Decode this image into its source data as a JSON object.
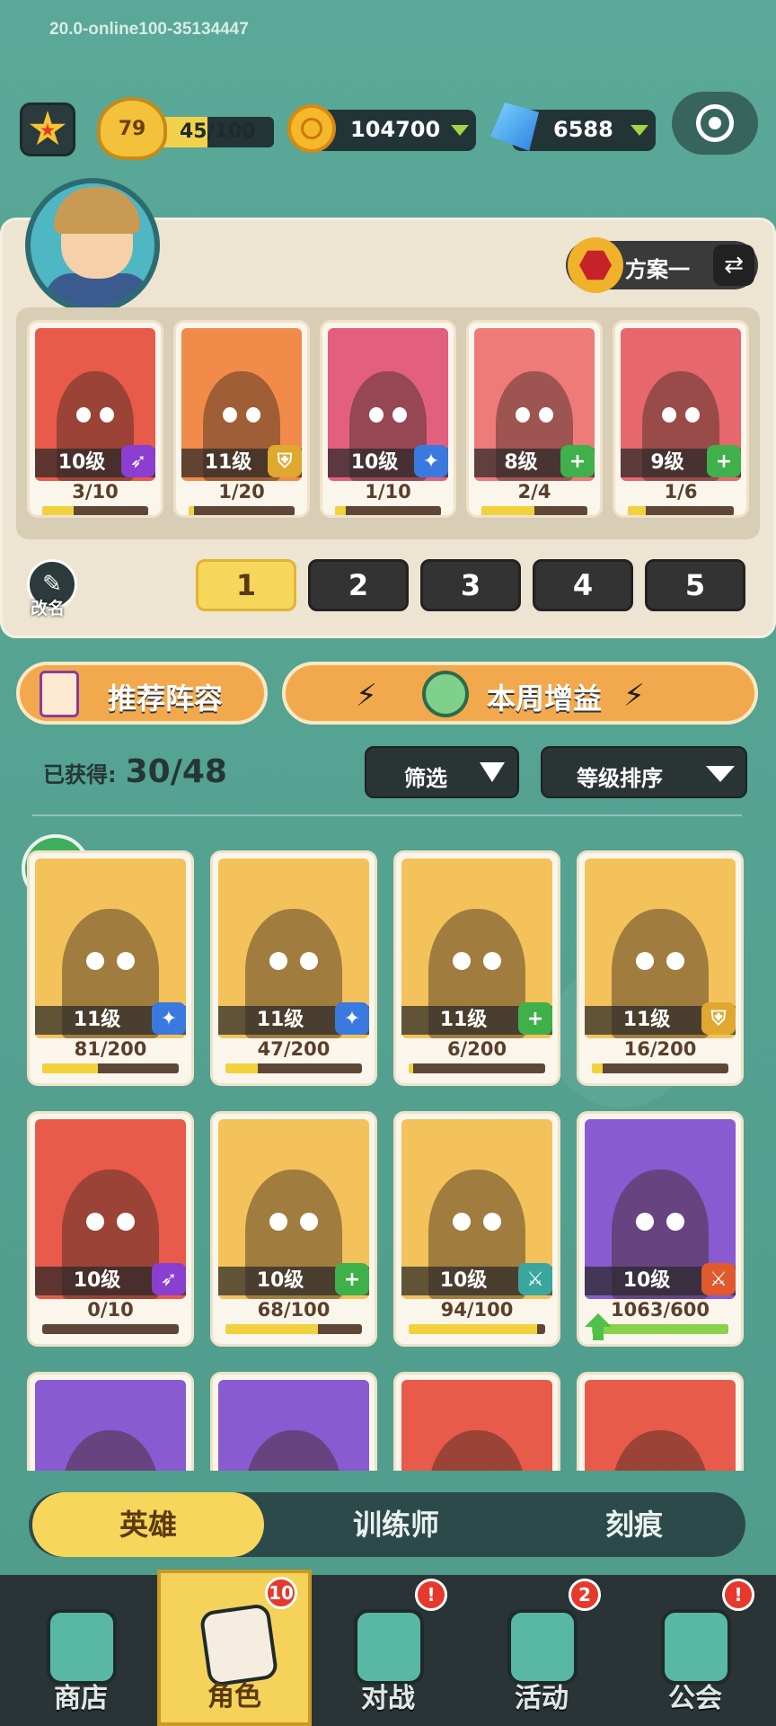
{
  "version": "20.0-online100-35134447",
  "player": {
    "level": "79",
    "exp": "45/100",
    "exp_fraction": 0.45
  },
  "resources": {
    "gold": "104700",
    "gems": "6588"
  },
  "scheme": {
    "label": "方案一"
  },
  "deck": {
    "heroes": [
      {
        "level": "10级",
        "progress": "3/10",
        "fill": 0.3,
        "class": "archer",
        "color": "#e85a4a"
      },
      {
        "level": "11级",
        "progress": "1/20",
        "fill": 0.05,
        "class": "shield",
        "color": "#f28a4a"
      },
      {
        "level": "10级",
        "progress": "1/10",
        "fill": 0.1,
        "class": "mage",
        "color": "#e2607e"
      },
      {
        "level": "8级",
        "progress": "2/4",
        "fill": 0.5,
        "class": "heal",
        "color": "#ef7a7a"
      },
      {
        "level": "9级",
        "progress": "1/6",
        "fill": 0.17,
        "class": "heal",
        "color": "#e6686e"
      }
    ],
    "slots": [
      "1",
      "2",
      "3",
      "4",
      "5"
    ],
    "active_slot": "1",
    "rename_label": "改名"
  },
  "buttons": {
    "recommend": "推荐阵容",
    "weekly": "本周增益",
    "filter": "筛选",
    "sort": "等级排序"
  },
  "collection": {
    "owned_label": "已获得:",
    "owned_value": "30/48"
  },
  "heroes": [
    {
      "level": "11级",
      "progress": "81/200",
      "fill": 0.405,
      "class": "mage",
      "color": "#f3c25a"
    },
    {
      "level": "11级",
      "progress": "47/200",
      "fill": 0.235,
      "class": "mage",
      "color": "#f3c25a"
    },
    {
      "level": "11级",
      "progress": "6/200",
      "fill": 0.03,
      "class": "heal",
      "color": "#f3c25a"
    },
    {
      "level": "11级",
      "progress": "16/200",
      "fill": 0.08,
      "class": "shield",
      "color": "#f3c25a"
    },
    {
      "level": "10级",
      "progress": "0/10",
      "fill": 0,
      "class": "archer",
      "color": "#e85a4a"
    },
    {
      "level": "10级",
      "progress": "68/100",
      "fill": 0.68,
      "class": "heal",
      "color": "#f3c25a"
    },
    {
      "level": "10级",
      "progress": "94/100",
      "fill": 0.94,
      "class": "blade",
      "color": "#f3c25a"
    },
    {
      "level": "10级",
      "progress": "1063/600",
      "fill": 1,
      "class": "sword",
      "color": "#8a5ad0"
    },
    {
      "color": "#8a5ad0"
    },
    {
      "color": "#8a5ad0"
    },
    {
      "color": "#e85a4a"
    },
    {
      "color": "#e85a4a"
    }
  ],
  "tabs": [
    "英雄",
    "训练师",
    "刻痕"
  ],
  "nav": [
    {
      "label": "商店",
      "badge": ""
    },
    {
      "label": "角色",
      "badge": "10"
    },
    {
      "label": "对战",
      "badge": "!"
    },
    {
      "label": "活动",
      "badge": "2"
    },
    {
      "label": "公会",
      "badge": "!"
    }
  ],
  "colors": {
    "accent": "#f6d75b",
    "bg": "#5aa595",
    "archer": "#8a3fd0",
    "shield": "#e0a82e",
    "mage": "#3a7ae0",
    "heal": "#3fb04a",
    "blade": "#3aa6a0",
    "sword": "#e05a2e"
  }
}
